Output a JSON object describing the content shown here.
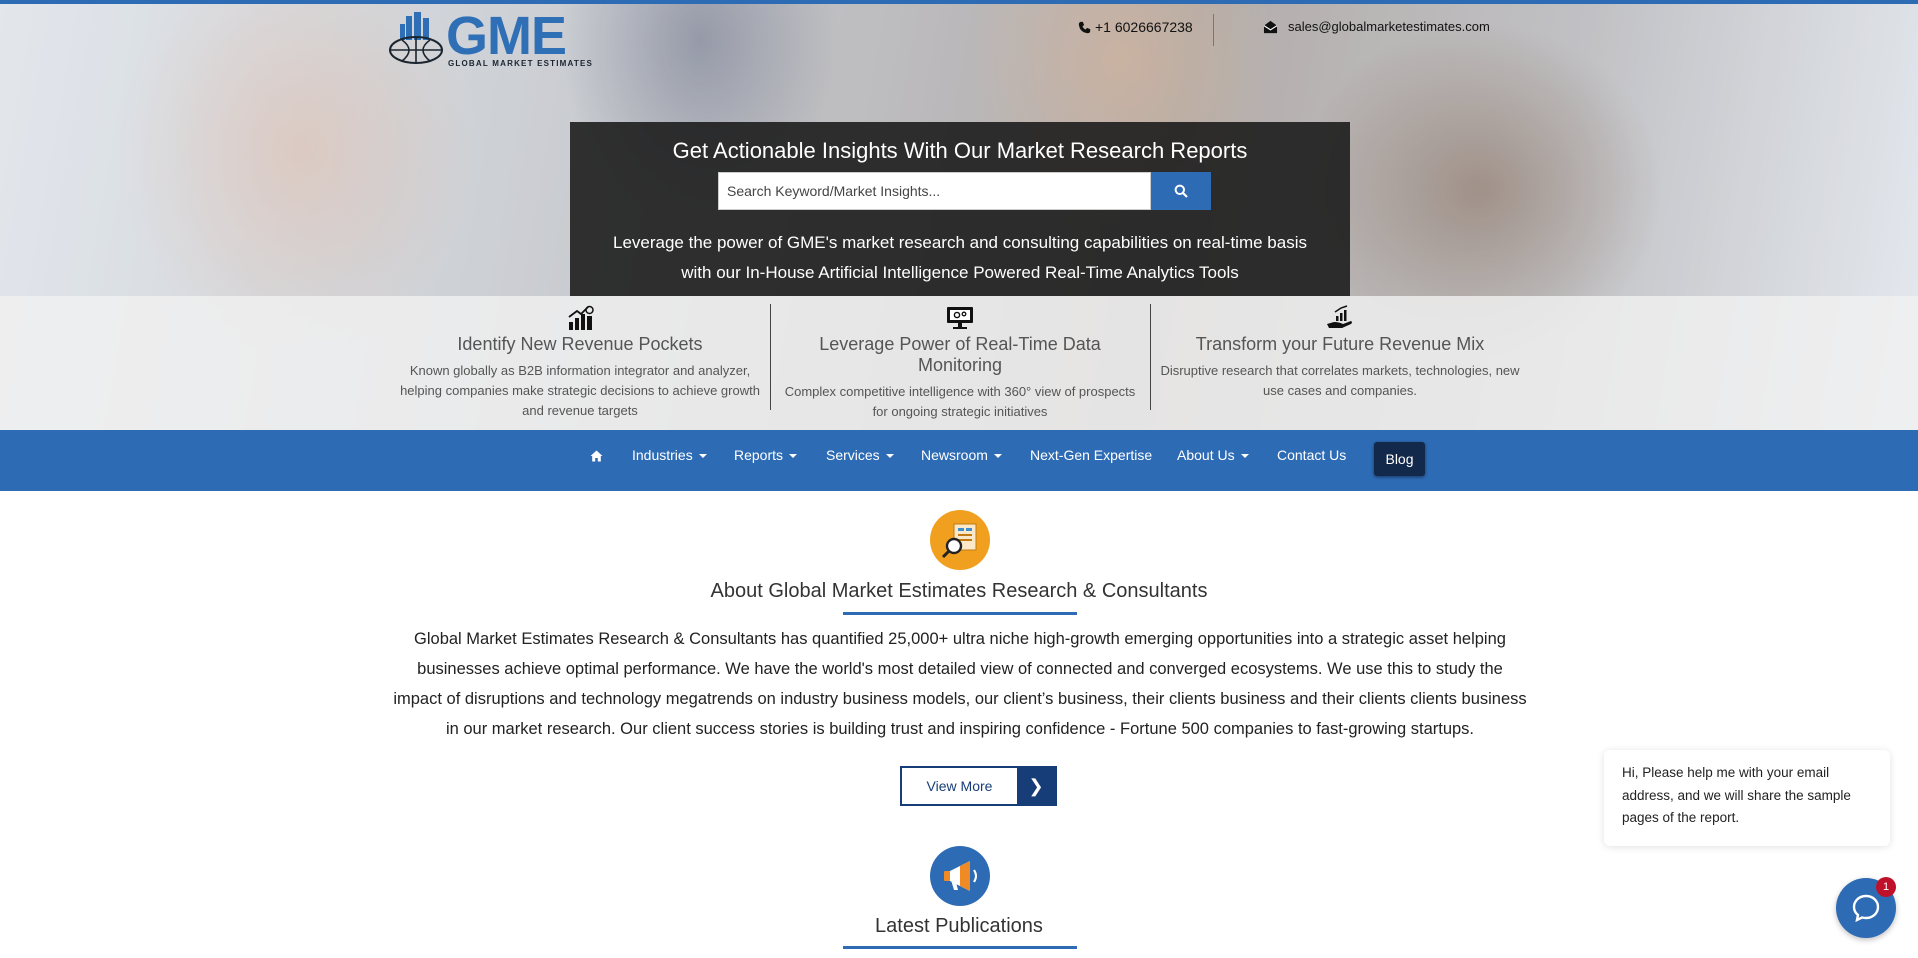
{
  "header": {
    "logo": {
      "wordmark": "GME",
      "tagline": "GLOBAL MARKET ESTIMATES"
    },
    "phone": "+1 6026667238",
    "email": "sales@globalmarketestimates.com"
  },
  "hero": {
    "heading": "Get Actionable Insights With Our Market Research Reports",
    "search": {
      "placeholder": "Search Keyword/Market Insights...",
      "value": ""
    },
    "tagline_line1": "Leverage the power of GME's market research and consulting capabilities on real-time basis",
    "tagline_line2": "with our In-House Artificial Intelligence Powered Real-Time Analytics Tools"
  },
  "features": [
    {
      "icon": "bar-chart-icon",
      "title": "Identify New Revenue Pockets",
      "text_line1": "Known globally as B2B information integrator and analyzer,",
      "text_line2": "helping companies make strategic decisions to achieve growth",
      "text_line3": "and revenue targets"
    },
    {
      "icon": "monitor-icon",
      "title": "Leverage Power of Real-Time Data Monitoring",
      "text_line1": "Complex competitive intelligence with 360° view of prospects",
      "text_line2": "for ongoing strategic initiatives"
    },
    {
      "icon": "growth-hand-icon",
      "title": "Transform your Future Revenue Mix",
      "text_line1": "Disruptive research that correlates markets, technologies, new",
      "text_line2": "use cases and companies."
    }
  ],
  "nav": {
    "items": [
      {
        "label": "Industries"
      },
      {
        "label": "Reports"
      },
      {
        "label": "Services"
      },
      {
        "label": "Newsroom"
      },
      {
        "label": "Next-Gen Expertise"
      },
      {
        "label": "About Us"
      },
      {
        "label": "Contact Us"
      }
    ],
    "blog": "Blog"
  },
  "about": {
    "title": "About Global Market Estimates Research & Consultants",
    "line1": "Global Market Estimates Research & Consultants has quantified 25,000+ ultra niche high-growth emerging opportunities into a strategic asset helping",
    "line2": "businesses achieve optimal performance. We have the world's most detailed view of connected and converged ecosystems. We use this to study the",
    "line3": "impact of disruptions and technology megatrends on industry business models, our client’s business, their clients business and their clients clients business",
    "line4": "in our market research. Our client success stories is building trust and inspiring confidence - Fortune 500 companies to fast-growing startups.",
    "view_more": "View More",
    "view_more_arrow": "❯"
  },
  "publications": {
    "title": "Latest Publications"
  },
  "chat": {
    "message_line1": "Hi, Please help me with your email",
    "message_line2": "address, and we will share the sample",
    "message_line3": "pages of the report.",
    "badge": "1"
  },
  "colors": {
    "brand_blue": "#2d6bb5",
    "navy": "#173d78",
    "blog_bg": "#13294b",
    "badge_red": "#c0112a",
    "about_icon": "#f0a01e"
  }
}
